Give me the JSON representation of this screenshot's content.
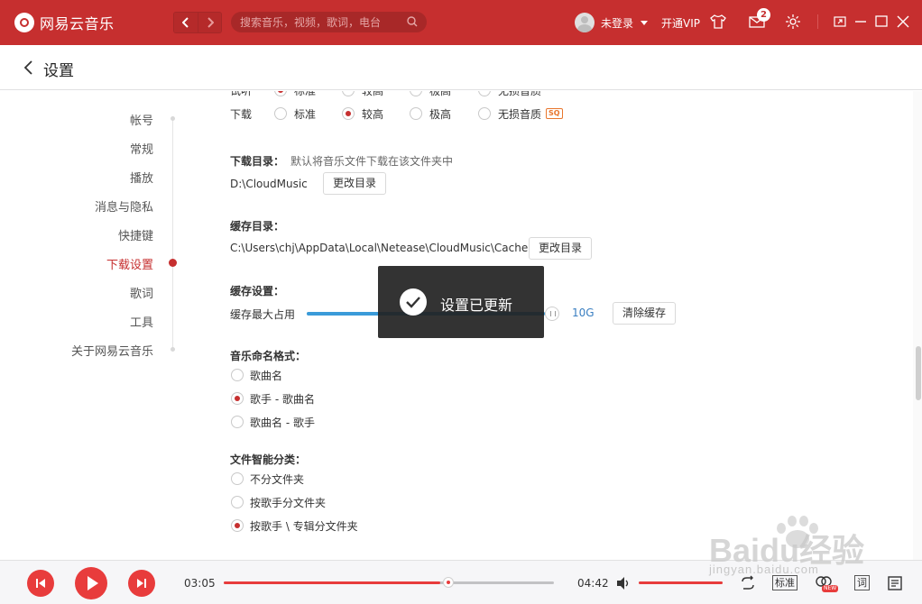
{
  "app": {
    "title": "网易云音乐",
    "accent_color": "#c62f2f"
  },
  "topbar": {
    "search_placeholder": "搜索音乐，视频，歌词，电台",
    "user_name": "未登录",
    "vip_label": "开通VIP",
    "message_count": "2",
    "icons": [
      "back-icon",
      "forward-icon",
      "search-icon",
      "avatar",
      "dropdown-icon",
      "tshirt-skin-icon",
      "mail-icon",
      "gear-icon",
      "mini-mode-icon",
      "minimize-icon",
      "maximize-icon",
      "close-icon"
    ]
  },
  "page": {
    "title": "设置"
  },
  "nav": {
    "items": [
      {
        "label": "帐号"
      },
      {
        "label": "常规"
      },
      {
        "label": "播放"
      },
      {
        "label": "消息与隐私"
      },
      {
        "label": "快捷键"
      },
      {
        "label": "下载设置",
        "active": true
      },
      {
        "label": "歌词"
      },
      {
        "label": "工具"
      },
      {
        "label": "关于网易云音乐"
      }
    ]
  },
  "settings": {
    "trial_row": {
      "label": "试听",
      "options": [
        "标准",
        "较高",
        "极高",
        "无损音质"
      ],
      "selected": 0
    },
    "download_row": {
      "label": "下载",
      "options": [
        "标准",
        "较高",
        "极高",
        "无损音质"
      ],
      "selected": 1,
      "sq_tag": "SQ"
    },
    "download_dir": {
      "label": "下载目录：",
      "hint": "默认将音乐文件下载在该文件夹中",
      "path": "D:\\CloudMusic",
      "button": "更改目录"
    },
    "cache_dir": {
      "label": "缓存目录：",
      "path": "C:\\Users\\chj\\AppData\\Local\\Netease\\CloudMusic\\Cache",
      "button": "更改目录"
    },
    "cache_settings": {
      "label": "缓存设置：",
      "max_label": "缓存最大占用",
      "value": "10G",
      "fill_fraction": 0.97,
      "clear_button": "清除缓存"
    },
    "naming": {
      "label": "音乐命名格式：",
      "options": [
        "歌曲名",
        "歌手 - 歌曲名",
        "歌曲名 - 歌手"
      ],
      "selected": 1
    },
    "classify": {
      "label": "文件智能分类：",
      "options": [
        "不分文件夹",
        "按歌手分文件夹",
        "按歌手 \\ 专辑分文件夹"
      ],
      "selected": 2
    }
  },
  "toast": {
    "message": "设置已更新"
  },
  "player": {
    "current_time": "03:05",
    "total_time": "04:42",
    "progress_fraction": 0.656,
    "volume_fraction": 1.0,
    "quality_label": "标准",
    "lyric_label": "词",
    "new_label": "NEW"
  },
  "watermark": {
    "text": "Baidu经验",
    "subtext": "jingyan.baidu.com"
  }
}
